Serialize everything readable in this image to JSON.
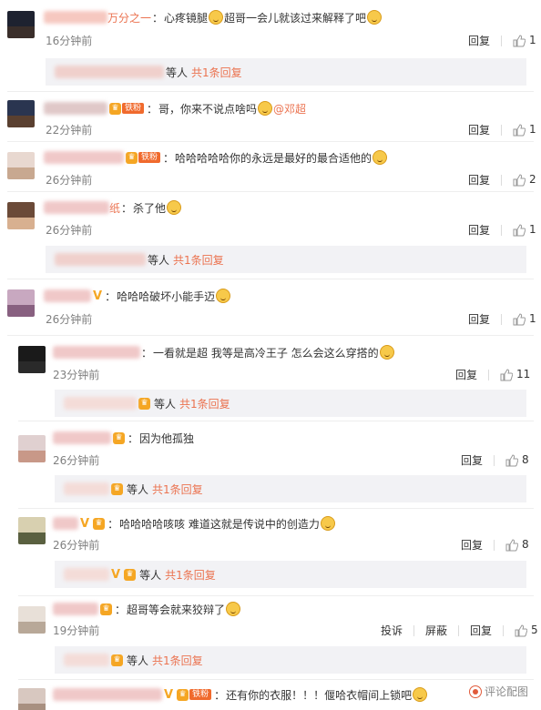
{
  "comments": [
    {
      "name_suffix": "万分之一",
      "text": "心疼镜腿",
      "text2": "超哥一会儿就该过来解释了吧",
      "time": "16分钟前",
      "reply_label": "回复",
      "like_count": "1",
      "thread": {
        "etc": "等人",
        "more": "共1条回复"
      }
    },
    {
      "badge": "铁粉",
      "text": "哥，你来不说点啥吗",
      "mention": "@邓超",
      "time": "22分钟前",
      "reply_label": "回复",
      "like_count": "1"
    },
    {
      "badge": "铁粉",
      "text": "哈哈哈哈哈你的永远是最好的最合适他的",
      "time": "26分钟前",
      "reply_label": "回复",
      "like_count": "2"
    },
    {
      "name_suffix": "纸",
      "text": "杀了他",
      "time": "26分钟前",
      "reply_label": "回复",
      "like_count": "1",
      "thread": {
        "etc": "等人",
        "more": "共1条回复"
      }
    },
    {
      "text": "哈哈哈破坏小能手迈",
      "time": "26分钟前",
      "reply_label": "回复",
      "like_count": "1"
    },
    {
      "text": "一看就是超 我等是高冷王子 怎么会这么穿搭的",
      "time": "23分钟前",
      "reply_label": "回复",
      "like_count": "11",
      "thread": {
        "etc": "等人",
        "more": "共1条回复"
      }
    },
    {
      "text": "因为他孤独",
      "time": "26分钟前",
      "reply_label": "回复",
      "like_count": "8",
      "thread": {
        "etc": "等人",
        "more": "共1条回复"
      }
    },
    {
      "text": "哈哈哈哈咳咳 难道这就是传说中的创造力",
      "time": "26分钟前",
      "reply_label": "回复",
      "like_count": "8",
      "thread": {
        "etc": "等人",
        "more": "共1条回复"
      }
    },
    {
      "text": "超哥等会就来狡辩了",
      "time": "19分钟前",
      "report_label": "投诉",
      "block_label": "屏蔽",
      "reply_label": "回复",
      "like_count": "5",
      "thread": {
        "etc": "等人",
        "more": "共1条回复"
      }
    },
    {
      "badge": "铁粉",
      "text": "还有你的衣服！！！偃哈衣帽间上锁吧"
    }
  ],
  "watermark": "评论配图",
  "colors": {
    "accent": "#eb7350",
    "reply_bg": "#f2f2f5",
    "time": "#808080"
  }
}
